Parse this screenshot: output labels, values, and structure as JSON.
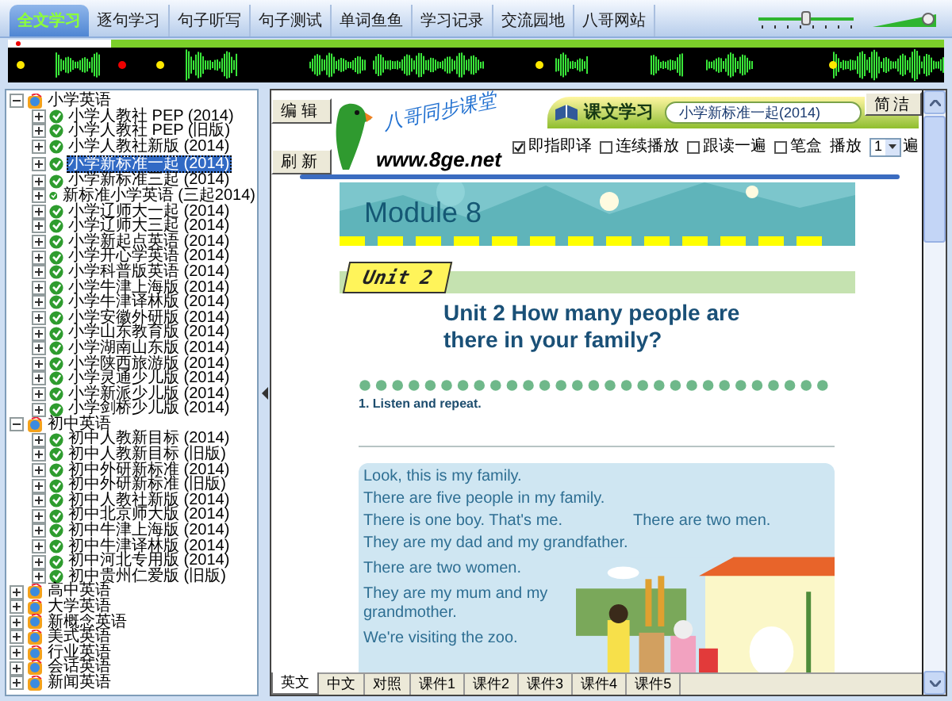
{
  "toolbar": {
    "tabs": [
      {
        "label": "全文学习",
        "selected": true
      },
      {
        "label": "逐句学习",
        "selected": false
      },
      {
        "label": "句子听写",
        "selected": false
      },
      {
        "label": "句子测试",
        "selected": false
      },
      {
        "label": "单词鱼鱼",
        "selected": false
      },
      {
        "label": "学习记录",
        "selected": false
      },
      {
        "label": "交流园地",
        "selected": false
      },
      {
        "label": "八哥网站",
        "selected": false
      }
    ],
    "speed_slider": {
      "level": 0.5
    },
    "volume_slider": {
      "level": 0.92
    }
  },
  "progress": {
    "level": 0.11
  },
  "tree": [
    {
      "label": "小学英语",
      "expanded": true,
      "selected": false,
      "children": [
        {
          "label": "小学人教社 PEP (2014)",
          "expanded": false,
          "selected": false
        },
        {
          "label": "小学人教社 PEP (旧版)",
          "expanded": false,
          "selected": false
        },
        {
          "label": "小学人教社新版 (2014)",
          "expanded": false,
          "selected": false
        },
        {
          "label": "小学新标准一起 (2014)",
          "expanded": false,
          "selected": true
        },
        {
          "label": "小学新标准三起 (2014)",
          "expanded": false,
          "selected": false
        },
        {
          "label": "新标准小学英语 (三起2014)",
          "expanded": false,
          "selected": false
        },
        {
          "label": "小学辽师大一起 (2014)",
          "expanded": false,
          "selected": false
        },
        {
          "label": "小学辽师大三起 (2014)",
          "expanded": false,
          "selected": false
        },
        {
          "label": "小学新起点英语 (2014)",
          "expanded": false,
          "selected": false
        },
        {
          "label": "小学开心学英语 (2014)",
          "expanded": false,
          "selected": false
        },
        {
          "label": "小学科普版英语 (2014)",
          "expanded": false,
          "selected": false
        },
        {
          "label": "小学牛津上海版 (2014)",
          "expanded": false,
          "selected": false
        },
        {
          "label": "小学牛津译林版 (2014)",
          "expanded": false,
          "selected": false
        },
        {
          "label": "小学安徽外研版 (2014)",
          "expanded": false,
          "selected": false
        },
        {
          "label": "小学山东教育版 (2014)",
          "expanded": false,
          "selected": false
        },
        {
          "label": "小学湖南山东版 (2014)",
          "expanded": false,
          "selected": false
        },
        {
          "label": "小学陕西旅游版 (2014)",
          "expanded": false,
          "selected": false
        },
        {
          "label": "小学灵通少儿版 (2014)",
          "expanded": false,
          "selected": false
        },
        {
          "label": "小学新派少儿版 (2014)",
          "expanded": false,
          "selected": false
        },
        {
          "label": "小学剑桥少儿版 (2014)",
          "expanded": false,
          "selected": false
        }
      ]
    },
    {
      "label": "初中英语",
      "expanded": true,
      "selected": false,
      "children": [
        {
          "label": "初中人教新目标 (2014)",
          "expanded": false,
          "selected": false
        },
        {
          "label": "初中人教新目标 (旧版)",
          "expanded": false,
          "selected": false
        },
        {
          "label": "初中外研新标准 (2014)",
          "expanded": false,
          "selected": false
        },
        {
          "label": "初中外研新标准 (旧版)",
          "expanded": false,
          "selected": false
        },
        {
          "label": "初中人教社新版 (2014)",
          "expanded": false,
          "selected": false
        },
        {
          "label": "初中北京师大版 (2014)",
          "expanded": false,
          "selected": false
        },
        {
          "label": "初中牛津上海版 (2014)",
          "expanded": false,
          "selected": false
        },
        {
          "label": "初中牛津译林版 (2014)",
          "expanded": false,
          "selected": false
        },
        {
          "label": "初中河北专用版 (2014)",
          "expanded": false,
          "selected": false
        },
        {
          "label": "初中贵州仁爱版 (旧版)",
          "expanded": false,
          "selected": false
        }
      ]
    },
    {
      "label": "高中英语",
      "expanded": false,
      "selected": false
    },
    {
      "label": "大学英语",
      "expanded": false,
      "selected": false
    },
    {
      "label": "新概念英语",
      "expanded": false,
      "selected": false
    },
    {
      "label": "美式英语",
      "expanded": false,
      "selected": false
    },
    {
      "label": "行业英语",
      "expanded": false,
      "selected": false
    },
    {
      "label": "会话英语",
      "expanded": false,
      "selected": false
    },
    {
      "label": "新闻英语",
      "expanded": false,
      "selected": false
    }
  ],
  "header": {
    "side_buttons": [
      "编辑",
      "刷新"
    ],
    "logo_title": "八哥同步课堂",
    "logo_url": "www.8ge.net",
    "section_title": "课文学习",
    "book_field": "小学新标准一起(2014)",
    "mode_button": "简洁",
    "options": [
      {
        "label": "即指即译",
        "checked": true
      },
      {
        "label": "连续播放",
        "checked": false
      },
      {
        "label": "跟读一遍",
        "checked": false
      },
      {
        "label": "笔盒",
        "checked": false
      }
    ],
    "repeat": {
      "label": "播放",
      "value": "1",
      "suffix": "遍"
    }
  },
  "lesson": {
    "module": "Module 8",
    "unit_badge": "Unit 2",
    "title": "Unit 2 How many people are there in your family?",
    "instruction": "1. Listen and repeat.",
    "rows": [
      [
        "Look, this is my family."
      ],
      [
        "There are five people in my family."
      ],
      [
        "There is one boy. That's me.",
        "There are two men."
      ],
      [
        "They are my dad and my grandfather."
      ],
      [
        "There are two women."
      ],
      [
        "They are my mum and my grandmother."
      ],
      [
        "We're visiting the zoo."
      ]
    ]
  },
  "bottom_tabs": [
    {
      "label": "英文",
      "selected": true
    },
    {
      "label": "中文",
      "selected": false
    },
    {
      "label": "对照",
      "selected": false
    },
    {
      "label": "课件1",
      "selected": false
    },
    {
      "label": "课件2",
      "selected": false
    },
    {
      "label": "课件3",
      "selected": false
    },
    {
      "label": "课件4",
      "selected": false
    },
    {
      "label": "课件5",
      "selected": false
    }
  ]
}
